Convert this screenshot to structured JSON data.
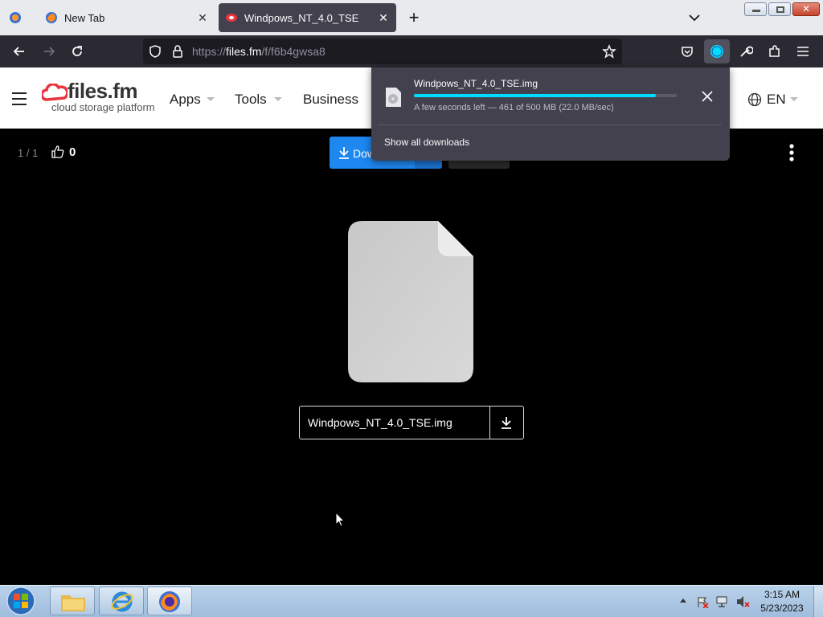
{
  "browser": {
    "tabs": [
      {
        "label": "New Tab"
      },
      {
        "label": "Windpows_NT_4.0_TSE"
      }
    ],
    "url": {
      "scheme": "https://",
      "host": "files.fm",
      "path": "/f/f6b4gwsa8"
    }
  },
  "site": {
    "logo_name": "files.fm",
    "logo_tagline": "cloud storage platform",
    "nav": [
      {
        "label": "Apps"
      },
      {
        "label": "Tools"
      },
      {
        "label": "Business"
      }
    ],
    "language": "EN",
    "brand_color": "#e8343f"
  },
  "viewer": {
    "counter": "1 / 1",
    "likes": "0",
    "download_label": "Download",
    "accent_color": "#1e87f0",
    "filename": "Windpows_NT_4.0_TSE.img"
  },
  "downloads_panel": {
    "filename": "Windpows_NT_4.0_TSE.img",
    "status": "A few seconds left — 461 of 500 MB (22.0 MB/sec)",
    "progress_fraction": 0.92,
    "show_all_label": "Show all downloads",
    "progress_color": "#00ddff"
  },
  "taskbar": {
    "time": "3:15 AM",
    "date": "5/23/2023",
    "pinned": [
      "start-orb",
      "file-explorer",
      "internet-explorer",
      "firefox"
    ]
  }
}
